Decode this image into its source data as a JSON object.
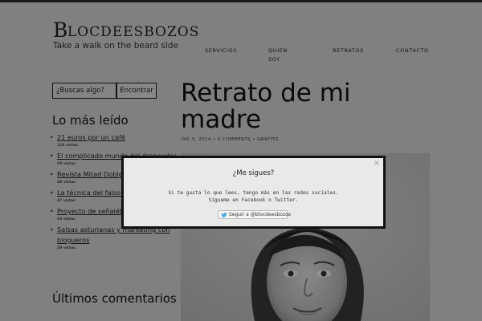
{
  "site": {
    "logo_initial": "B",
    "logo_rest": "LOCDEESBOZOS",
    "tagline": "Take a walk on the beard side"
  },
  "nav": {
    "items": [
      "SERVICIOS",
      "QUIEN SOY",
      "RETRATOS",
      "CONTACTO"
    ]
  },
  "sidebar": {
    "search_placeholder": "¿Buscas algo?",
    "search_button": "Encontrar",
    "popular_heading": "Lo más leído",
    "popular": [
      {
        "title": "21 euros por un café",
        "views": "116 vistas"
      },
      {
        "title": "El complicado mundo del drapeados",
        "views": "59 vistas"
      },
      {
        "title": "Revista Mitad Doble n",
        "views": "49 vistas"
      },
      {
        "title": "La técnica del falso gi",
        "views": "47 vistas"
      },
      {
        "title": "Proyecto de señaléticas colegio",
        "views": "43 vistas"
      },
      {
        "title": "Salsas asturianas y marketing con blogueros",
        "views": "29 vistas"
      }
    ],
    "comments_heading": "Últimos comentarios"
  },
  "post": {
    "title": "Retrato de mi madre",
    "date": "DIC 5, 2014",
    "comments": "0 COMMENTS",
    "category": "GRAFITO",
    "separator": "•"
  },
  "modal": {
    "close": "×",
    "title": "¿Me sigues?",
    "line1": "Si te gusta lo que lees, tengo más en las redes sociales.",
    "line2": "Sígueme en Facebook o Twitter.",
    "follow_label": "Seguir a @blocdeesbozos"
  },
  "colors": {
    "page_bg": "#d6d6d6",
    "overlay": "rgba(0,0,0,0.4)",
    "modal_bg": "#e9e9e9",
    "twitter_blue": "#4aa3df"
  },
  "icons": {
    "close": "close-icon",
    "twitter": "twitter-bird-icon"
  }
}
